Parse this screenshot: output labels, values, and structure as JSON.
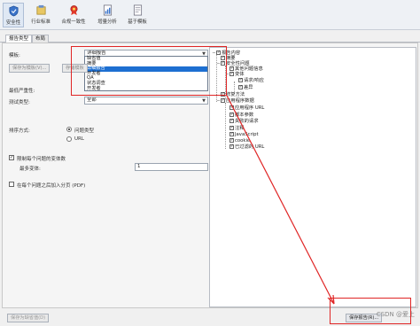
{
  "toolbar": {
    "items": [
      {
        "label": "安全性",
        "icon": "shield-icon",
        "active": true
      },
      {
        "label": "行业标准",
        "icon": "scale-icon",
        "active": false
      },
      {
        "label": "合规一致性",
        "icon": "ribbon-icon",
        "active": false
      },
      {
        "label": "增量分析",
        "icon": "document-chart-icon",
        "active": false
      },
      {
        "label": "基于模板",
        "icon": "template-icon",
        "active": false
      }
    ]
  },
  "tabs": [
    {
      "label": "报告类型",
      "active": true
    },
    {
      "label": "布局",
      "active": false
    }
  ],
  "form": {
    "template_label": "模板:",
    "template_value": "详细报告",
    "template_options": [
      "详细报告",
      "缺省值",
      "摘要",
      "详细报告",
      "开发者",
      "QA",
      "状态调查",
      "开发者"
    ],
    "template_selected_index": 3,
    "save_template_button": "保存为模板(V)...",
    "second_button": "存储模板",
    "min_severity_label": "最低严重性:",
    "test_type_label": "测试类型:",
    "test_type_value": "全部",
    "sort_label": "排序方式:",
    "sort_options": [
      {
        "label": "问题类型",
        "checked": true
      },
      {
        "label": "URL",
        "checked": false
      }
    ],
    "limit_checkbox_label": "限制每个问题的变体数",
    "limit_checked": true,
    "max_variants_label": "最多变体:",
    "max_variants_value": "1",
    "page_break_label": "在每个问题之后加入分页 (PDF)",
    "page_break_checked": false
  },
  "tree": {
    "nodes": [
      {
        "label": "报告内容",
        "level": 0,
        "checked": true,
        "expanded": true
      },
      {
        "label": "摘要",
        "level": 1,
        "checked": true,
        "expanded": false
      },
      {
        "label": "安全性问题",
        "level": 1,
        "checked": true,
        "expanded": true
      },
      {
        "label": "其他问题信息",
        "level": 2,
        "checked": true,
        "expanded": false
      },
      {
        "label": "变体",
        "level": 2,
        "checked": true,
        "expanded": true
      },
      {
        "label": "请求/响应",
        "level": 3,
        "checked": true,
        "expanded": false
      },
      {
        "label": "差异",
        "level": 3,
        "checked": true,
        "expanded": false
      },
      {
        "label": "修复方法",
        "level": 1,
        "checked": true,
        "expanded": false
      },
      {
        "label": "应用程序数据",
        "level": 1,
        "checked": true,
        "expanded": true
      },
      {
        "label": "应用程序 URL",
        "level": 2,
        "checked": true,
        "expanded": false
      },
      {
        "label": "脚本参数",
        "level": 2,
        "checked": true,
        "expanded": false
      },
      {
        "label": "失败的请求",
        "level": 2,
        "checked": true,
        "expanded": false
      },
      {
        "label": "注释",
        "level": 2,
        "checked": true,
        "expanded": false
      },
      {
        "label": "JavaScript",
        "level": 2,
        "checked": true,
        "expanded": false
      },
      {
        "label": "cookie",
        "level": 2,
        "checked": true,
        "expanded": false
      },
      {
        "label": "已过滤的 URL",
        "level": 2,
        "checked": true,
        "expanded": false
      }
    ]
  },
  "footer": {
    "save_default_button": "保存为缺省值(D)",
    "save_report_button": "保存报告(R)...",
    "watermark": "CSDN @爱上"
  },
  "colors": {
    "highlight": "#1d6fd1",
    "annotation": "#e02525"
  }
}
